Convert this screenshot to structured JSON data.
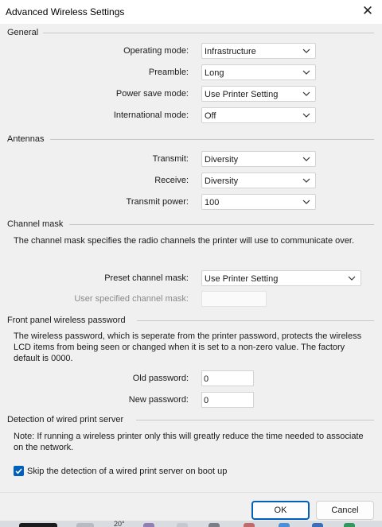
{
  "window": {
    "title": "Advanced Wireless Settings",
    "close_glyph": "✕"
  },
  "general": {
    "heading": "General",
    "operating_mode": {
      "label": "Operating mode:",
      "value": "Infrastructure"
    },
    "preamble": {
      "label": "Preamble:",
      "value": "Long"
    },
    "power_save_mode": {
      "label": "Power save mode:",
      "value": "Use Printer Setting"
    },
    "international_mode": {
      "label": "International mode:",
      "value": "Off"
    }
  },
  "antennas": {
    "heading": "Antennas",
    "transmit": {
      "label": "Transmit:",
      "value": "Diversity"
    },
    "receive": {
      "label": "Receive:",
      "value": "Diversity"
    },
    "transmit_power": {
      "label": "Transmit power:",
      "value": "100"
    }
  },
  "channel_mask": {
    "heading": "Channel mask",
    "description": "The channel mask specifies the radio channels the printer will use to communicate over.",
    "preset": {
      "label": "Preset channel mask:",
      "value": "Use Printer Setting"
    },
    "user_specified": {
      "label": "User specified channel mask:",
      "value": ""
    }
  },
  "front_panel_password": {
    "heading": "Front panel wireless password",
    "description": "The wireless password, which is seperate from the printer password, protects the wireless LCD items from being seen or changed when it is set to a non-zero value. The factory default is 0000.",
    "old_password": {
      "label": "Old password:",
      "value": "0"
    },
    "new_password": {
      "label": "New password:",
      "value": "0"
    }
  },
  "wired_detection": {
    "heading": "Detection of wired print server",
    "note": "Note: If running a wireless printer only this will greatly reduce the time needed to associate on the network.",
    "skip_checkbox": {
      "label": "Skip the detection of a wired print server on boot up",
      "checked": true
    }
  },
  "buttons": {
    "ok": "OK",
    "cancel": "Cancel"
  },
  "taskbar": {
    "temperature": "20°"
  },
  "colors": {
    "accent": "#005fb8",
    "window_bg": "#f0f0f0"
  },
  "icons": [
    "close-icon",
    "chevron-down-icon",
    "checkmark-icon"
  ]
}
